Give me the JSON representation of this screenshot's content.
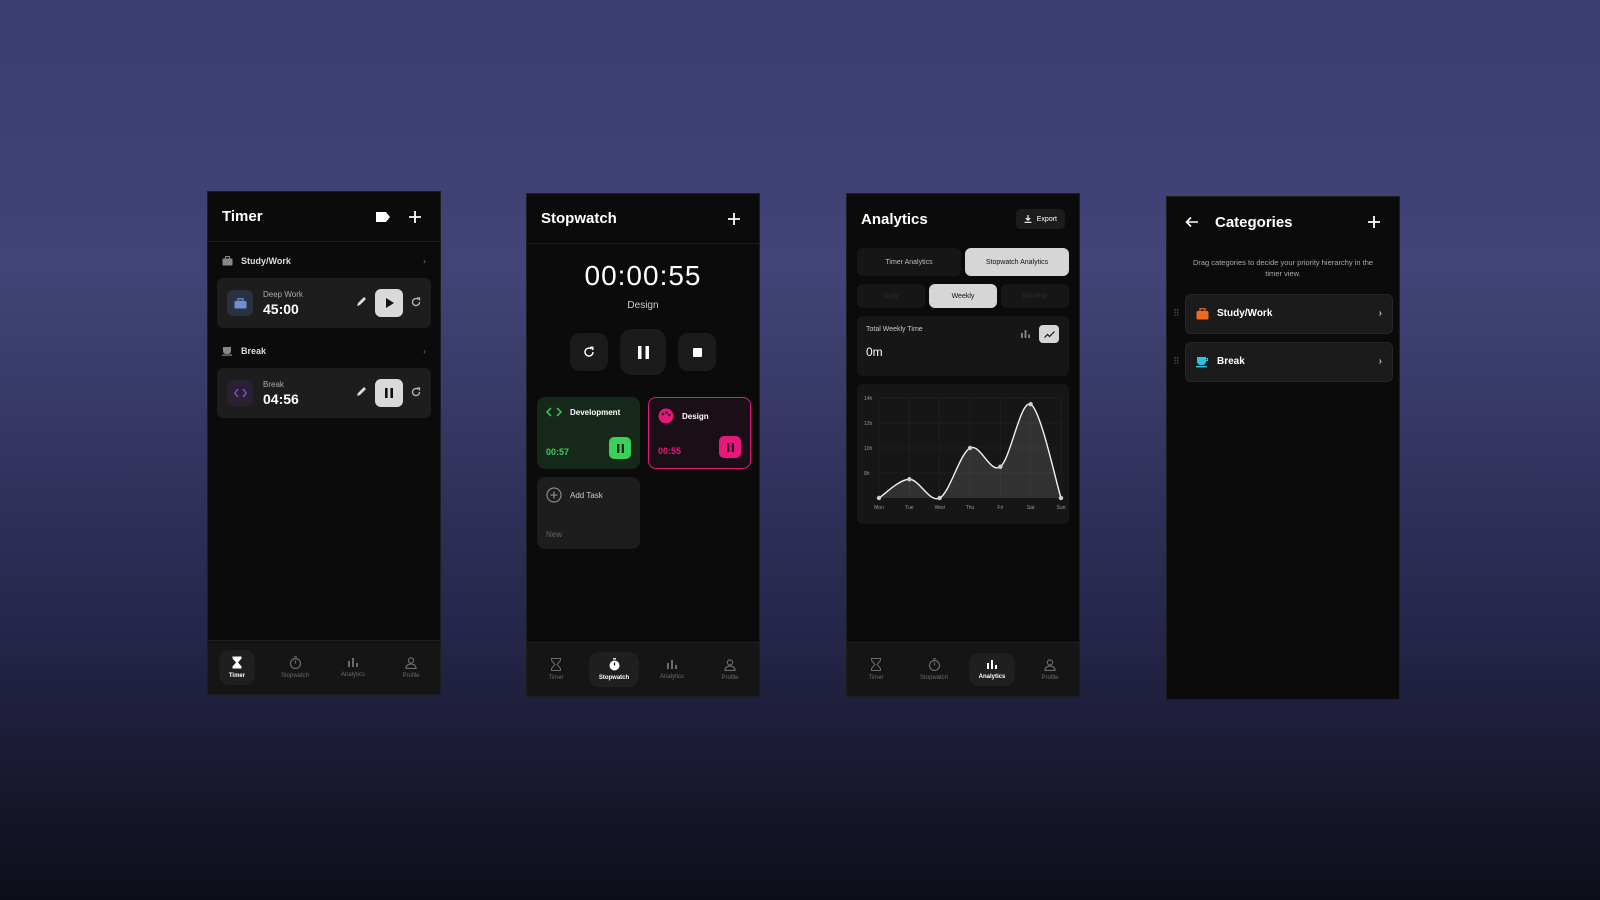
{
  "colors": {
    "green": "#3ccf5c",
    "pink": "#e8177c",
    "orange": "#f06a1d",
    "cyan": "#2fc2e0"
  },
  "nav": {
    "timer": "Timer",
    "stopwatch": "Stopwatch",
    "analytics": "Analytics",
    "profile": "Profile"
  },
  "timer": {
    "title": "Timer",
    "categories": [
      {
        "name": "Study/Work",
        "icon": "briefcase-icon",
        "task": "Deep Work",
        "time": "45:00",
        "state": "paused"
      },
      {
        "name": "Break",
        "icon": "coffee-icon",
        "task": "Break",
        "time": "04:56",
        "state": "running"
      }
    ]
  },
  "stopwatch": {
    "title": "Stopwatch",
    "time": "00:00:55",
    "current": "Design",
    "tasks": [
      {
        "name": "Development",
        "time": "00:57"
      },
      {
        "name": "Design",
        "time": "00:55"
      }
    ],
    "add_label": "Add Task",
    "add_sub": "New"
  },
  "analytics": {
    "title": "Analytics",
    "export": "Export",
    "tabs": [
      "Timer Analytics",
      "Stopwatch Analytics"
    ],
    "periods": [
      "Daily",
      "Weekly",
      "Monthly"
    ],
    "total_label": "Total Weekly Time",
    "total_value": "0m"
  },
  "chart_data": {
    "type": "line",
    "categories": [
      "Mon",
      "Tue",
      "Wed",
      "Thu",
      "Fri",
      "Sat",
      "Sun"
    ],
    "values": [
      6,
      7.5,
      6,
      10,
      8.5,
      13.5,
      6
    ],
    "yticks": [
      "14h",
      "12h",
      "10h",
      "8h"
    ],
    "ylim": [
      6,
      14
    ],
    "grid": true
  },
  "categories": {
    "title": "Categories",
    "description": "Drag categories to decide your priority hierarchy in the timer view.",
    "items": [
      {
        "name": "Study/Work",
        "icon": "briefcase-icon"
      },
      {
        "name": "Break",
        "icon": "coffee-icon"
      }
    ]
  }
}
